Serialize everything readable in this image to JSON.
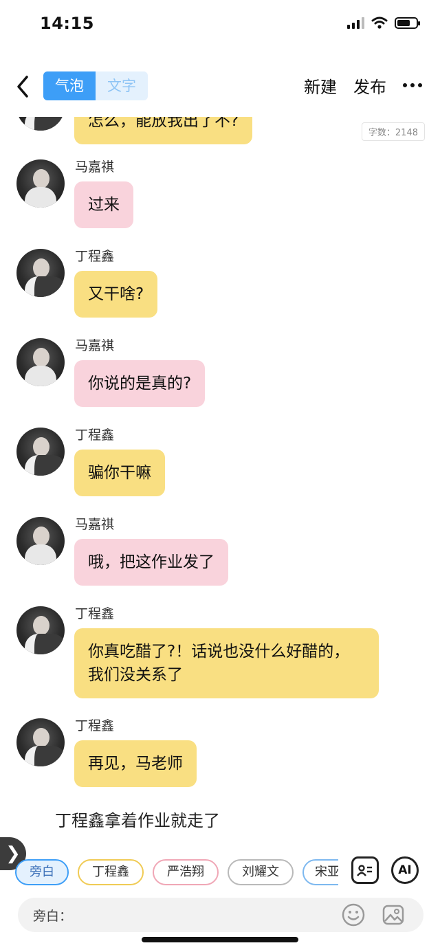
{
  "status_bar": {
    "time": "14:15"
  },
  "nav": {
    "tabs": [
      {
        "label": "气泡",
        "active": true
      },
      {
        "label": "文字",
        "active": false
      }
    ],
    "new_label": "新建",
    "publish_label": "发布"
  },
  "word_count": "字数：2148",
  "messages": [
    {
      "speaker": "马嘉祺",
      "text": "过来",
      "color": "pink"
    },
    {
      "speaker": "丁程鑫",
      "text": "又干啥?",
      "color": "yellow"
    },
    {
      "speaker": "马嘉祺",
      "text": "你说的是真的?",
      "color": "pink"
    },
    {
      "speaker": "丁程鑫",
      "text": "骗你干嘛",
      "color": "yellow"
    },
    {
      "speaker": "马嘉祺",
      "text": "哦，把这作业发了",
      "color": "pink"
    },
    {
      "speaker": "丁程鑫",
      "text": "你真吃醋了?！话说也没什么好醋的，我们没关系了",
      "color": "yellow"
    },
    {
      "speaker": "丁程鑫",
      "text": "再见，马老师",
      "color": "yellow"
    }
  ],
  "partial_top_bubble": "怎么，能放我出了不?",
  "narration": "丁程鑫拿着作业就走了",
  "drawer_icon": "chevron-right-icon",
  "roles": [
    "旁白",
    "丁程鑫",
    "严浩翔",
    "刘耀文",
    "宋亚"
  ],
  "selected_role": "旁白",
  "ai_label": "AI",
  "input": {
    "placeholder": "旁白："
  },
  "colors": {
    "accent": "#3d9ef7",
    "pink_bubble": "#f9d3dc",
    "yellow_bubble": "#f9df82"
  }
}
